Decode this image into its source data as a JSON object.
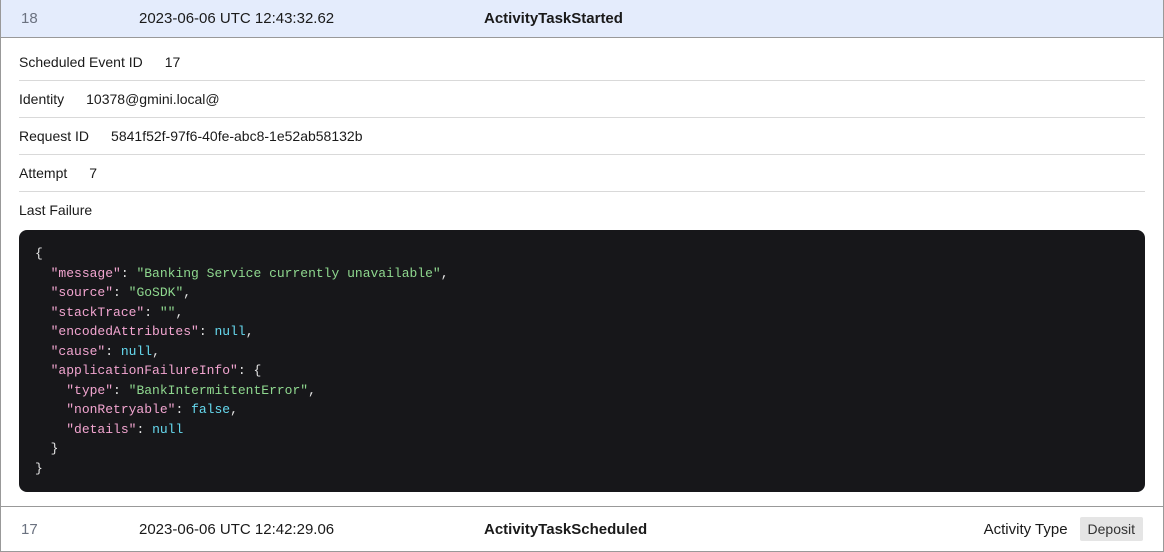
{
  "rows": [
    {
      "id": "18",
      "timestamp": "2023-06-06 UTC 12:43:32.62",
      "name": "ActivityTaskStarted"
    },
    {
      "id": "17",
      "timestamp": "2023-06-06 UTC 12:42:29.06",
      "name": "ActivityTaskScheduled",
      "activityTypeLabel": "Activity Type",
      "activityType": "Deposit"
    }
  ],
  "details": {
    "scheduledEventId": {
      "label": "Scheduled Event ID",
      "value": "17"
    },
    "identity": {
      "label": "Identity",
      "value": "10378@gmini.local@"
    },
    "requestId": {
      "label": "Request ID",
      "value": "5841f52f-97f6-40fe-abc8-1e52ab58132b"
    },
    "attempt": {
      "label": "Attempt",
      "value": "7"
    },
    "lastFailure": {
      "label": "Last Failure"
    }
  },
  "failureJson": {
    "message": "Banking Service currently unavailable",
    "source": "GoSDK",
    "stackTrace": "",
    "encodedAttributes": null,
    "cause": null,
    "applicationFailureInfo": {
      "type": "BankIntermittentError",
      "nonRetryable": false,
      "details": null
    }
  }
}
